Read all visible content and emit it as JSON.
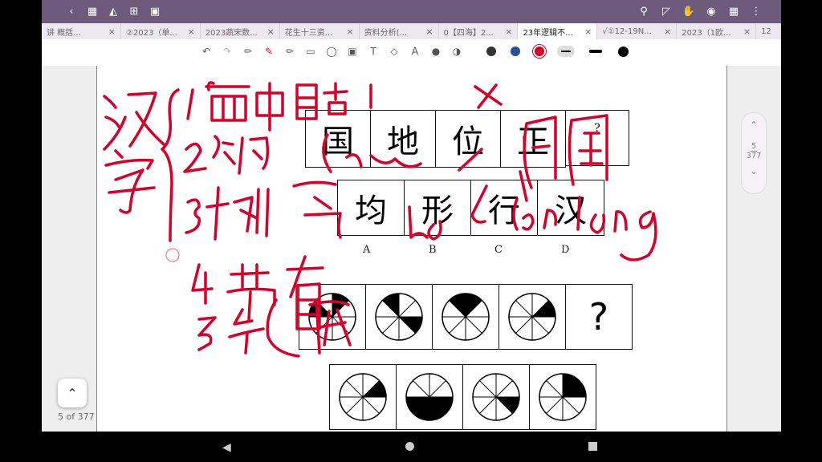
{
  "tabs": [
    {
      "label": "讲 概括..."
    },
    {
      "label": "②2023（单..."
    },
    {
      "label": "2023蔬宋数..."
    },
    {
      "label": "花生十三资..."
    },
    {
      "label": "资料分析(..."
    },
    {
      "label": "0【四海】2..."
    },
    {
      "label": "23年逻辑不..."
    },
    {
      "label": "√①12-19N..."
    },
    {
      "label": "2023（1欧..."
    },
    {
      "label": "12"
    }
  ],
  "puzzle1": {
    "row1": [
      "国",
      "地",
      "位",
      "正",
      "?"
    ],
    "options": [
      "均",
      "形",
      "行",
      "汉"
    ],
    "option_labels": [
      "A",
      "B",
      "C",
      "D"
    ]
  },
  "puzzle2": {
    "question_mark": "?"
  },
  "pagination": {
    "current": "5",
    "total": "377",
    "label": "5 of 377"
  },
  "colors": {
    "ink": "#d6002a",
    "toolbar": "#6b5a7a",
    "tabs_bg": "#ece8ef"
  }
}
